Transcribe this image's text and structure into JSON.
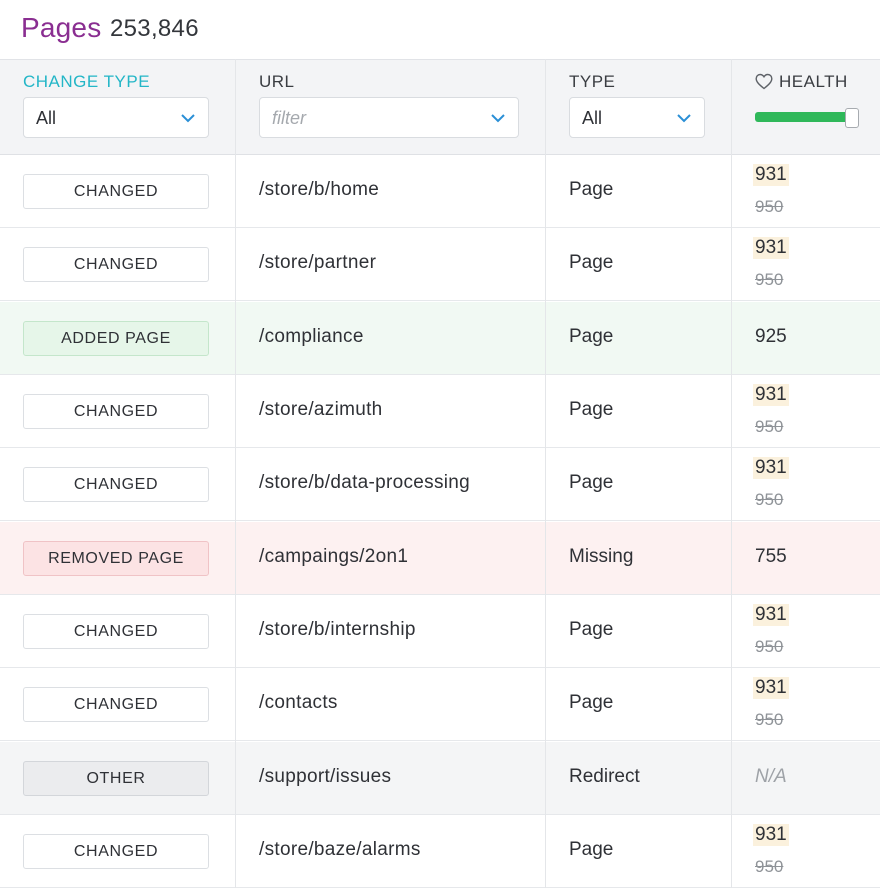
{
  "title": {
    "label": "Pages",
    "count": "253,846"
  },
  "columns": {
    "change_type": {
      "label": "CHANGE TYPE",
      "value": "All"
    },
    "url": {
      "label": "URL",
      "placeholder": "filter"
    },
    "type": {
      "label": "TYPE",
      "value": "All"
    },
    "health": {
      "label": "HEALTH",
      "icon": "heart-icon",
      "slider_level": 1.0,
      "bar_color": "#2fb85a"
    }
  },
  "colors": {
    "accent": "#23b6c7",
    "title": "#8a2e91",
    "added_bg": "#f1f9f3",
    "removed_bg": "#fdf1f1"
  },
  "rows": [
    {
      "change": "CHANGED",
      "kind": "changed",
      "url": "/store/b/home",
      "type": "Page",
      "health_new": "931",
      "health_old": "950"
    },
    {
      "change": "CHANGED",
      "kind": "changed",
      "url": "/store/partner",
      "type": "Page",
      "health_new": "931",
      "health_old": "950"
    },
    {
      "change": "ADDED PAGE",
      "kind": "added",
      "url": "/compliance",
      "type": "Page",
      "health": "925"
    },
    {
      "change": "CHANGED",
      "kind": "changed",
      "url": "/store/azimuth",
      "type": "Page",
      "health_new": "931",
      "health_old": "950"
    },
    {
      "change": "CHANGED",
      "kind": "changed",
      "url": "/store/b/data-processing",
      "type": "Page",
      "health_new": "931",
      "health_old": "950"
    },
    {
      "change": "REMOVED PAGE",
      "kind": "removed",
      "url": "/campaings/2on1",
      "type": "Missing",
      "health": "755"
    },
    {
      "change": "CHANGED",
      "kind": "changed",
      "url": "/store/b/internship",
      "type": "Page",
      "health_new": "931",
      "health_old": "950"
    },
    {
      "change": "CHANGED",
      "kind": "changed",
      "url": "/contacts",
      "type": "Page",
      "health_new": "931",
      "health_old": "950"
    },
    {
      "change": "OTHER",
      "kind": "other",
      "url": "/support/issues",
      "type": "Redirect",
      "health_na": "N/A"
    },
    {
      "change": "CHANGED",
      "kind": "changed",
      "url": "/store/baze/alarms",
      "type": "Page",
      "health_new": "931",
      "health_old": "950"
    }
  ]
}
